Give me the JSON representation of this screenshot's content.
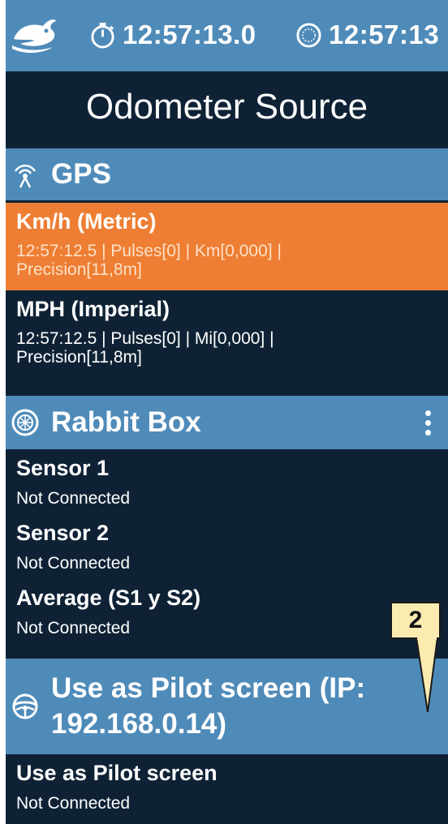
{
  "status_bar": {
    "clock1": "12:57:13.0",
    "clock2": "12:57:13"
  },
  "title": "Odometer Source",
  "gps": {
    "header": "GPS",
    "items": [
      {
        "label": "Km/h (Metric)",
        "detail1": "12:57:12.5 | Pulses[0] | Km[0,000] |",
        "detail2": "Precision[11,8m]",
        "selected": true
      },
      {
        "label": "MPH (Imperial)",
        "detail1": "12:57:12.5 | Pulses[0] | Mi[0,000] |",
        "detail2": "Precision[11,8m]",
        "selected": false
      }
    ]
  },
  "rabbit_box": {
    "header": "Rabbit Box",
    "items": [
      {
        "label": "Sensor 1",
        "status": "Not Connected"
      },
      {
        "label": "Sensor 2",
        "status": "Not Connected"
      },
      {
        "label": "Average (S1 y S2)",
        "status": "Not Connected"
      }
    ]
  },
  "pilot": {
    "header_line1": "Use as Pilot screen (IP:",
    "header_line2": "192.168.0.14)",
    "items": [
      {
        "label": "Use as Pilot screen",
        "status": "Not Connected"
      }
    ]
  },
  "callout": {
    "number": "2"
  },
  "colors": {
    "background": "#0f2235",
    "header": "#4f8bb9",
    "selected": "#ee7e33",
    "callout_fill": "#fcebb0"
  },
  "icons": [
    "rabbit-logo-icon",
    "stopwatch-icon",
    "clock-icon",
    "gps-antenna-icon",
    "wheel-icon",
    "more-vert-icon",
    "steering-wheel-icon"
  ]
}
